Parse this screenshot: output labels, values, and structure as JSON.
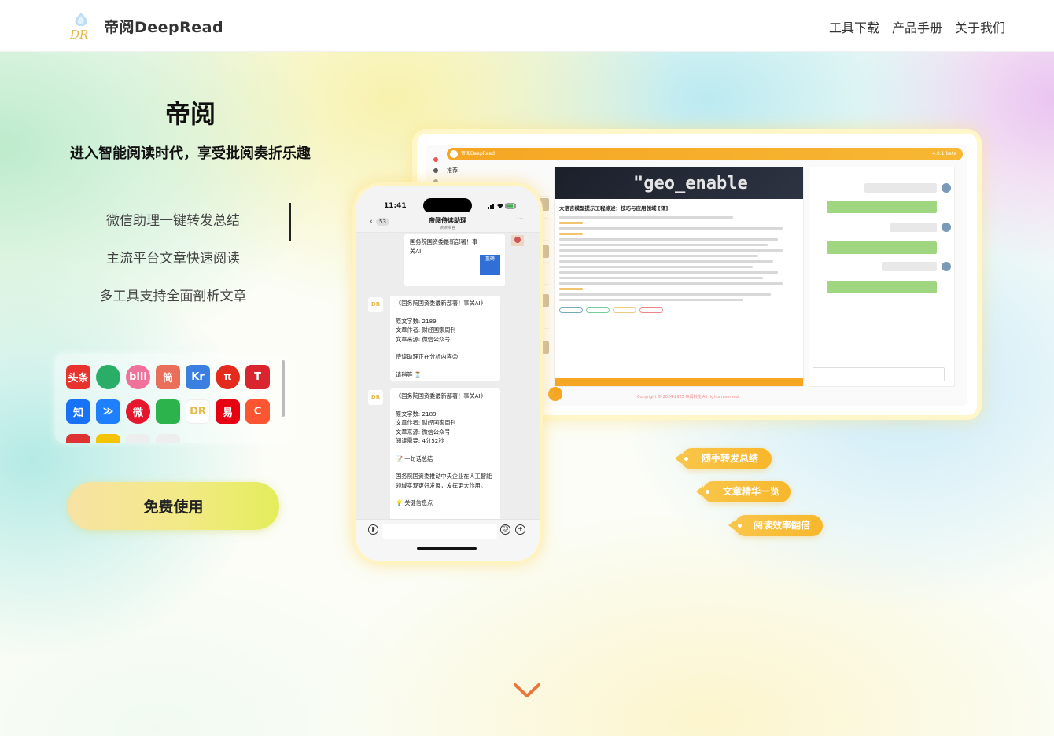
{
  "header": {
    "brand": "帝阅DeepRead",
    "logo_text": "DR",
    "nav": [
      "工具下载",
      "产品手册",
      "关于我们"
    ]
  },
  "hero": {
    "title": "帝阅",
    "subtitle": "进入智能阅读时代，享受批阅奏折乐趣",
    "features": [
      "微信助理一键转发总结",
      "主流平台文章快速阅读",
      "多工具支持全面剖析文章"
    ],
    "cta": "免费使用"
  },
  "platforms": [
    {
      "icon": "toutiao-icon",
      "text": "头条",
      "color": "#e8322d"
    },
    {
      "icon": "wechat-icon",
      "text": "",
      "color": "#2aae67"
    },
    {
      "icon": "bilibili-icon",
      "text": "bili",
      "color": "#f0719a"
    },
    {
      "icon": "jianshu-icon",
      "text": "简",
      "color": "#ea6f5a"
    },
    {
      "icon": "36kr-icon",
      "text": "Kr",
      "color": "#3b7fe0"
    },
    {
      "icon": "pi-icon",
      "text": "π",
      "color": "#e42a1c"
    },
    {
      "icon": "tf-icon",
      "text": "T",
      "color": "#d9262e"
    },
    {
      "icon": "zhihu-icon",
      "text": "知",
      "color": "#1772f6"
    },
    {
      "icon": "juejin-icon",
      "text": "≫",
      "color": "#1e80ff"
    },
    {
      "icon": "weibo-icon",
      "text": "微",
      "color": "#e6162d"
    },
    {
      "icon": "feather-icon",
      "text": "",
      "color": "#2db34b"
    },
    {
      "icon": "deepread-icon",
      "text": "DR",
      "color": "#ffffff"
    },
    {
      "icon": "fox-icon",
      "text": "易",
      "color": "#e60012"
    },
    {
      "icon": "csdn-icon",
      "text": "C",
      "color": "#fc5531"
    }
  ],
  "phone": {
    "time": "11:41",
    "chat_title": "帝阅侍读助理",
    "chat_sub": "读读帝官",
    "unread": "53",
    "messages": [
      {
        "title": "国务院国资委最新部署！事关AI",
        "lines": []
      },
      {
        "title": "《国务院国资委最新部署！事关AI》",
        "lines": [
          "原文字数: 2189",
          "文章作者: 财经国家周刊",
          "文章来源: 微信公众号",
          "",
          "侍读助理正在分析内容😊",
          "",
          "请稍等 ⏳"
        ]
      },
      {
        "title": "《国务院国资委最新部署！事关AI》",
        "lines": [
          "原文字数: 2189",
          "文章作者: 财经国家周刊",
          "文章来源: 微信公众号",
          "阅读需要: 4分52秒",
          "",
          "📝 一句话总结",
          "",
          "国务院国资委推动中央企业在人工智能领域实现更好发展，发挥更大作用。",
          "",
          "💡 关键信息点"
        ]
      }
    ],
    "badge": "重磅",
    "share_source": "财经国家周刊"
  },
  "desktop": {
    "app_name": "帝阅DeepRead",
    "version": "4.0.1 beta",
    "recommend": "推荐",
    "banner_text": "\"geo_enable",
    "article_title": "大语言模型提示工程综述：技巧与应用领域 [译]",
    "copyright": "Copyright © 2024-2025 帝阅科技 All rights reserved."
  },
  "tags": [
    "随手转发总结",
    "文章精华一览",
    "阅读效率翻倍"
  ],
  "colors": {
    "accent": "#f5a623",
    "cta_start": "#f7e2a4",
    "cta_end": "#e4ed5a",
    "chevron": "#e9763a"
  }
}
